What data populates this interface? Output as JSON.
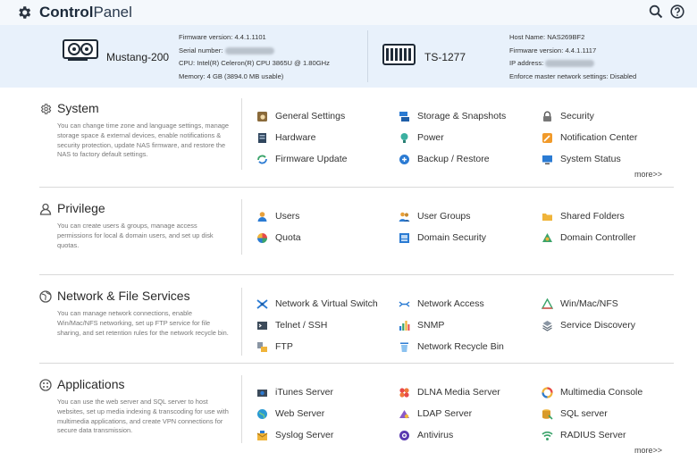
{
  "header": {
    "title_bold": "Control",
    "title_light": "Panel"
  },
  "devices": {
    "primary": {
      "name": "Mustang-200",
      "firmware": "Firmware version: 4.4.1.1101",
      "serial_label": "Serial number: ",
      "cpu": "CPU: Intel(R) Celeron(R) CPU 3865U @ 1.80GHz",
      "memory": "Memory: 4 GB (3894.0 MB usable)"
    },
    "secondary": {
      "name": "TS-1277",
      "host": "Host Name: NAS269BF2",
      "firmware": "Firmware version: 4.4.1.1117",
      "ip_label": "IP address: ",
      "enforce": "Enforce master network settings: Disabled"
    }
  },
  "sections": {
    "system": {
      "title": "System",
      "desc": "You can change time zone and language settings, manage storage space & external devices, enable notifications & security protection, update NAS firmware, and restore the NAS to factory default settings.",
      "items": [
        "General Settings",
        "Storage & Snapshots",
        "Security",
        "Hardware",
        "Power",
        "Notification Center",
        "Firmware Update",
        "Backup / Restore",
        "System Status"
      ],
      "more": "more>>"
    },
    "privilege": {
      "title": "Privilege",
      "desc": "You can create users & groups, manage access permissions for local & domain users, and set up disk quotas.",
      "items": [
        "Users",
        "User Groups",
        "Shared Folders",
        "Quota",
        "Domain Security",
        "Domain Controller"
      ]
    },
    "network": {
      "title": "Network & File Services",
      "desc": "You can manage network connections, enable Win/Mac/NFS networking, set up FTP service for file sharing, and set retention rules for the network recycle bin.",
      "items": [
        "Network & Virtual Switch",
        "Network Access",
        "Win/Mac/NFS",
        "Telnet / SSH",
        "SNMP",
        "Service Discovery",
        "FTP",
        "Network Recycle Bin"
      ]
    },
    "applications": {
      "title": "Applications",
      "desc": "You can use the web server and SQL server to host websites, set up media indexing & transcoding for use with multimedia applications, and create VPN connections for secure data transmission.",
      "items": [
        "iTunes Server",
        "DLNA Media Server",
        "Multimedia Console",
        "Web Server",
        "LDAP Server",
        "SQL server",
        "Syslog Server",
        "Antivirus",
        "RADIUS Server"
      ],
      "more": "more>>"
    }
  },
  "colors": {
    "header_bg": "#f4f8fc",
    "device_bg": "#e8f1fb",
    "accent_blue": "#2b7bd3"
  }
}
